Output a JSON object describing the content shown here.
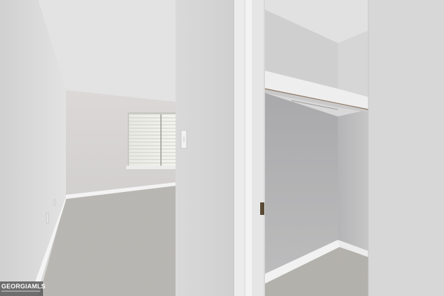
{
  "photo": {
    "description_scene": "interior-room-with-closet",
    "colors": {
      "wall_left": "#dcdcdc",
      "wall_back": "#d6d3d3",
      "ceiling": "#e4e4e4",
      "carpet": "#b4b2ad",
      "closet_wall": "#b8b8b8",
      "door_frame": "#efefef",
      "baseboard": "#f4f4f4"
    }
  },
  "watermark": {
    "text": "GEORGIAMLS"
  }
}
